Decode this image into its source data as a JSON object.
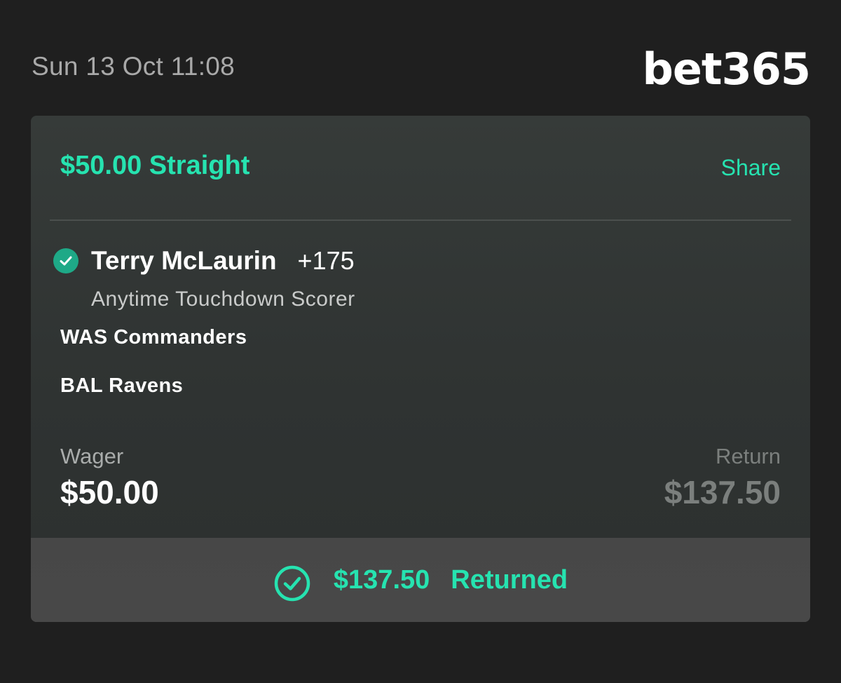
{
  "header": {
    "timestamp": "Sun 13 Oct 11:08",
    "logo_text": "bet365"
  },
  "bet": {
    "title": "$50.00 Straight",
    "share_label": "Share",
    "selection": {
      "name": "Terry McLaurin",
      "odds": "+175",
      "market": "Anytime Touchdown Scorer",
      "status_icon": "check-circle-filled-icon"
    },
    "teams": [
      "WAS Commanders",
      "BAL Ravens"
    ],
    "wager": {
      "label": "Wager",
      "value": "$50.00"
    },
    "return": {
      "label": "Return",
      "value": "$137.50"
    }
  },
  "footer": {
    "amount": "$137.50",
    "status": "Returned",
    "icon": "check-circle-outline-icon"
  },
  "colors": {
    "background": "#1f1f1f",
    "accent": "#26e3b0",
    "check_fill": "#1ea987",
    "card": "#333736",
    "footer": "#474747"
  }
}
